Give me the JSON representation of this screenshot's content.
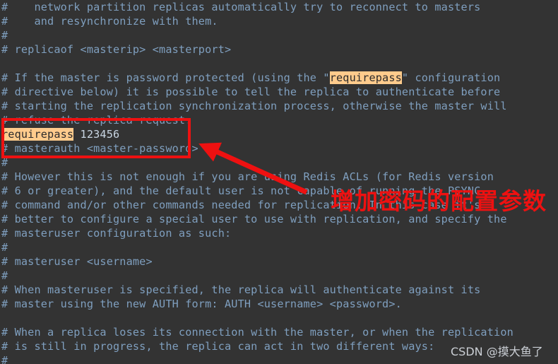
{
  "editor": {
    "background_color": "#333333",
    "comment_color": "#7f9fbf",
    "value_color": "#c9d6e3",
    "highlight_bg_color": "#ffcb8c",
    "highlight_fg_color": "#2b2b2b",
    "annotation_color": "#ee1111",
    "font_label": "monospace",
    "lines": [
      {
        "id": "l01",
        "segments": [
          {
            "type": "comment",
            "text": "#    network partition replicas automatically try to reconnect to masters"
          }
        ]
      },
      {
        "id": "l02",
        "segments": [
          {
            "type": "comment",
            "text": "#    and resynchronize with them."
          }
        ]
      },
      {
        "id": "l03",
        "segments": [
          {
            "type": "comment",
            "text": "#"
          }
        ]
      },
      {
        "id": "l04",
        "segments": [
          {
            "type": "comment",
            "text": "# replicaof <masterip> <masterport>"
          }
        ]
      },
      {
        "id": "l05",
        "segments": [
          {
            "type": "comment",
            "text": ""
          }
        ]
      },
      {
        "id": "l06",
        "segments": [
          {
            "type": "comment",
            "text": "# If the master is password protected (using the \""
          },
          {
            "type": "key",
            "text": "requirepass"
          },
          {
            "type": "comment",
            "text": "\" configuration"
          }
        ]
      },
      {
        "id": "l07",
        "segments": [
          {
            "type": "comment",
            "text": "# directive below) it is possible to tell the replica to authenticate before"
          }
        ]
      },
      {
        "id": "l08",
        "segments": [
          {
            "type": "comment",
            "text": "# starting the replication synchronization process, otherwise the master will"
          }
        ]
      },
      {
        "id": "l09",
        "segments": [
          {
            "type": "comment",
            "text": "# refuse the replica request."
          }
        ]
      },
      {
        "id": "l10",
        "segments": [
          {
            "type": "key",
            "text": "requirepass"
          },
          {
            "type": "value",
            "text": " 123456"
          }
        ]
      },
      {
        "id": "l11",
        "segments": [
          {
            "type": "comment",
            "text": "# masterauth <master-password>"
          }
        ]
      },
      {
        "id": "l12",
        "segments": [
          {
            "type": "comment",
            "text": "#"
          }
        ]
      },
      {
        "id": "l13",
        "segments": [
          {
            "type": "comment",
            "text": "# However this is not enough if you are using Redis ACLs (for Redis version"
          }
        ]
      },
      {
        "id": "l14",
        "segments": [
          {
            "type": "comment",
            "text": "# 6 or greater), and the default user is not capable of running the PSYNC"
          }
        ]
      },
      {
        "id": "l15",
        "segments": [
          {
            "type": "comment",
            "text": "# command and/or other commands needed for replication. In this case it's"
          }
        ]
      },
      {
        "id": "l16",
        "segments": [
          {
            "type": "comment",
            "text": "# better to configure a special user to use with replication, and specify the"
          }
        ]
      },
      {
        "id": "l17",
        "segments": [
          {
            "type": "comment",
            "text": "# masteruser configuration as such:"
          }
        ]
      },
      {
        "id": "l18",
        "segments": [
          {
            "type": "comment",
            "text": "#"
          }
        ]
      },
      {
        "id": "l19",
        "segments": [
          {
            "type": "comment",
            "text": "# masteruser <username>"
          }
        ]
      },
      {
        "id": "l20",
        "segments": [
          {
            "type": "comment",
            "text": "#"
          }
        ]
      },
      {
        "id": "l21",
        "segments": [
          {
            "type": "comment",
            "text": "# When masteruser is specified, the replica will authenticate against its"
          }
        ]
      },
      {
        "id": "l22",
        "segments": [
          {
            "type": "comment",
            "text": "# master using the new AUTH form: AUTH <username> <password>."
          }
        ]
      },
      {
        "id": "l23",
        "segments": [
          {
            "type": "comment",
            "text": ""
          }
        ]
      },
      {
        "id": "l24",
        "segments": [
          {
            "type": "comment",
            "text": "# When a replica loses its connection with the master, or when the replication"
          }
        ]
      },
      {
        "id": "l25",
        "segments": [
          {
            "type": "comment",
            "text": "# is still in progress, the replica can act in two different ways:"
          }
        ]
      },
      {
        "id": "l26",
        "segments": [
          {
            "type": "comment",
            "text": "#"
          }
        ]
      }
    ]
  },
  "annotations": {
    "highlight_box_label": "requirepass-config-highlight",
    "arrow_label": "pointer-arrow",
    "note_text": "增加密码的配置参数"
  },
  "watermark": {
    "text": "CSDN @摸大鱼了"
  }
}
